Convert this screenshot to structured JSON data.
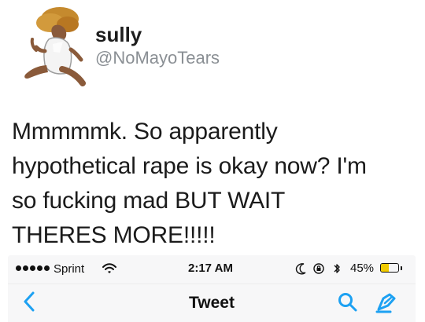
{
  "profile": {
    "display_name": "sully",
    "handle": "@NoMayoTears",
    "avatar_icon": "profile-avatar-illustration"
  },
  "tweet": {
    "lines": [
      "Mmmmmk. So apparently",
      "hypothetical rape is okay now? I'm",
      "so fucking mad BUT WAIT",
      "THERES MORE!!!!!"
    ]
  },
  "embedded_screenshot": {
    "status_bar": {
      "carrier": "Sprint",
      "time": "2:17 AM",
      "battery_percent_label": "45%",
      "battery_level": 0.45,
      "icons": [
        "signal-dots-icon",
        "wifi-icon",
        "moon-icon",
        "orientation-lock-icon",
        "bluetooth-icon",
        "battery-icon"
      ]
    },
    "nav_bar": {
      "title": "Tweet",
      "icons": [
        "back-chevron-icon",
        "search-icon",
        "compose-icon"
      ]
    }
  },
  "colors": {
    "text_primary": "#111111",
    "handle_gray": "#8a8f94",
    "accent_blue": "#1da1f2",
    "battery_yellow": "#f1cb00",
    "phone_bar_bg": "#f7f7f8"
  }
}
